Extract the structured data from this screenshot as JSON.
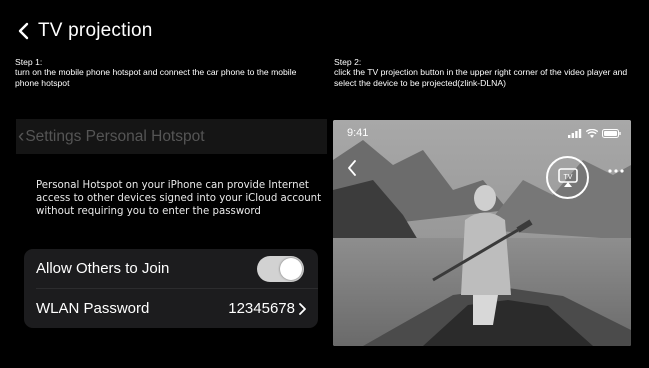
{
  "header": {
    "title": "TV projection",
    "back_icon": "chevron-left-icon"
  },
  "steps": {
    "step1": {
      "label": "Step 1:",
      "text": "turn on the mobile phone hotspot and connect the car phone to the mobile phone hotspot"
    },
    "step2": {
      "label": "Step 2:",
      "text": "click the TV projection button in the upper right corner of the video player and select the device to be projected(zlink-DLNA)"
    }
  },
  "settings": {
    "nav_title": "Settings Personal Hotspot",
    "description": "Personal Hotspot on your iPhone can provide Internet access to other devices signed into your iCloud account without requiring you to enter the password",
    "rows": {
      "allow_label": "Allow Others to Join",
      "allow_enabled": true,
      "password_label": "WLAN Password",
      "password_value": "12345678"
    }
  },
  "video": {
    "time": "9:41",
    "tv_label": "TV",
    "icons": [
      "signal-icon",
      "wifi-icon",
      "battery-icon",
      "tv-cast-icon",
      "more-icon"
    ]
  },
  "colors": {
    "background": "#000000",
    "panel": "#1c1c1e",
    "toggle_on": "#d2d2d2"
  }
}
